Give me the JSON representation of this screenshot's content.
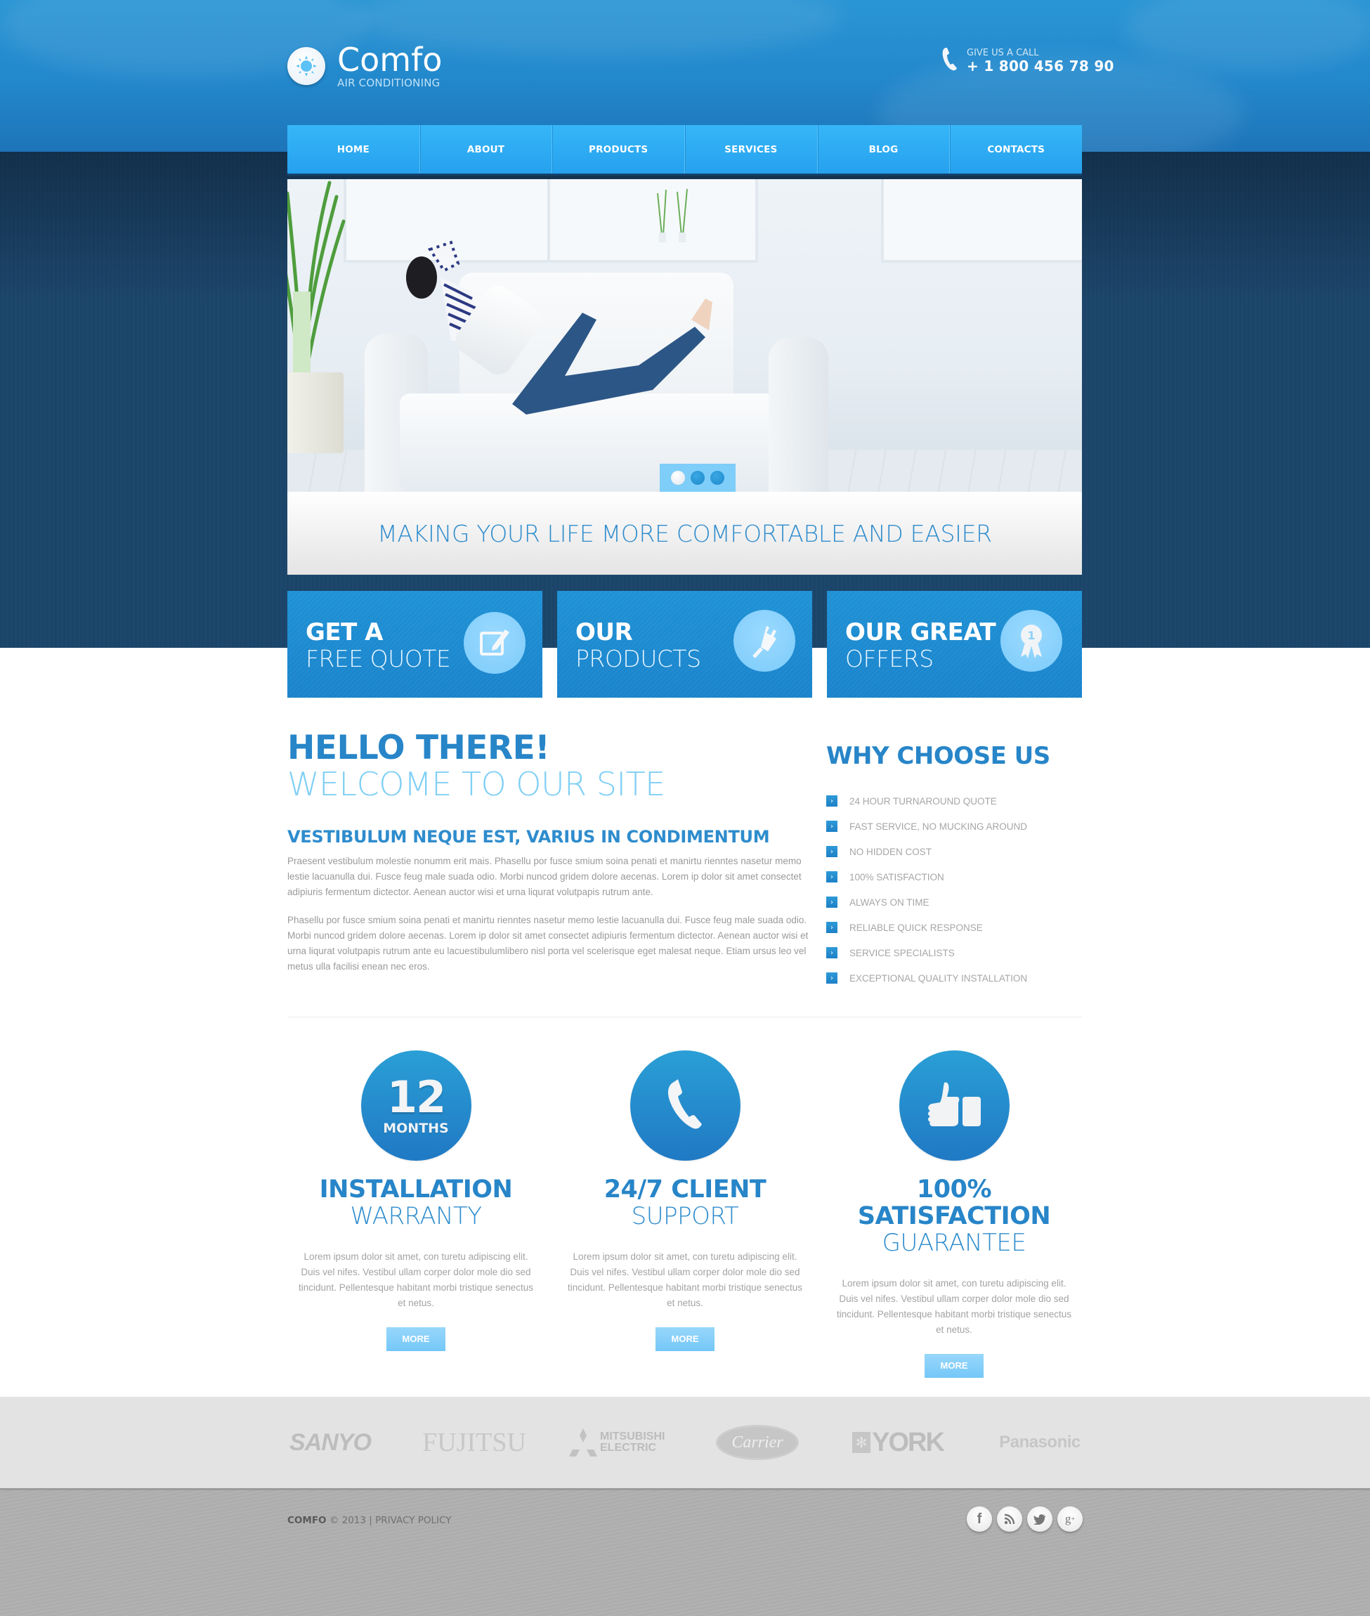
{
  "header": {
    "logo_name": "Comfo",
    "logo_tagline": "AIR CONDITIONING",
    "logo_icon": "sun-icon",
    "phone_label": "GIVE US A CALL",
    "phone_number": "+ 1 800 456 78 90",
    "phone_icon": "phone-icon"
  },
  "nav": {
    "items": [
      {
        "label": "HOME"
      },
      {
        "label": "ABOUT"
      },
      {
        "label": "PRODUCTS"
      },
      {
        "label": "SERVICES"
      },
      {
        "label": "BLOG"
      },
      {
        "label": "CONTACTS"
      }
    ]
  },
  "slider": {
    "slide_count": 3,
    "active_slide": 1,
    "tagline": "MAKING YOUR LIFE MORE COMFORTABLE AND EASIER"
  },
  "feature_boxes": [
    {
      "line1": "GET A",
      "line2": "FREE QUOTE",
      "icon": "edit-icon"
    },
    {
      "line1": "OUR",
      "line2": "PRODUCTS",
      "icon": "plug-icon"
    },
    {
      "line1": "OUR GREAT",
      "line2": "OFFERS",
      "icon": "award-ribbon-icon"
    }
  ],
  "welcome": {
    "title": "HELLO THERE!",
    "subtitle": "WELCOME TO OUR SITE",
    "heading": "VESTIBULUM NEQUE EST, VARIUS IN CONDIMENTUM",
    "paragraphs": [
      "Praesent vestibulum molestie nonumm erit mais. Phasellu por fusce smium soina penati et manirtu rienntes nasetur memo lestie lacuanulla dui. Fusce feug male suada odio. Morbi nuncod gridem dolore aecenas. Lorem ip dolor sit amet consectet adipiuris fermentum dictector. Aenean auctor wisi et urna liqurat volutpapis rutrum ante.",
      "Phasellu por fusce smium soina penati et manirtu rienntes nasetur memo lestie lacuanulla dui. Fusce feug male suada odio. Morbi nuncod gridem dolore aecenas. Lorem ip dolor sit amet consectet adipiuris fermentum dictector. Aenean auctor wisi et urna liqurat volutpapis rutrum ante eu lacuestibulumlibero nisl porta vel scelerisque eget malesat neque. Etiam ursus leo vel metus ulla facilisi enean nec eros."
    ]
  },
  "why_choose": {
    "title": "WHY CHOOSE US",
    "bullet_glyph": "›",
    "items": [
      "24 HOUR TURNAROUND QUOTE",
      "FAST SERVICE, NO MUCKING AROUND",
      "NO HIDDEN COST",
      "100% SATISFACTION",
      "ALWAYS ON TIME",
      "RELIABLE QUICK RESPONSE",
      "SERVICE SPECIALISTS",
      "EXCEPTIONAL QUALITY INSTALLATION"
    ]
  },
  "features": [
    {
      "badge_number": "12",
      "badge_unit": "MONTHS",
      "title_bold": "INSTALLATION",
      "title_light": "WARRANTY",
      "text": "Lorem ipsum dolor sit amet, con turetu adipiscing elit. Duis vel nifes. Vestibul ullam corper dolor mole dio sed tincidunt. Pellentesque habitant morbi tristique senectus et netus.",
      "button": "MORE"
    },
    {
      "icon": "phone-icon",
      "title_bold": "24/7 CLIENT",
      "title_light": "SUPPORT",
      "text": "Lorem ipsum dolor sit amet, con turetu adipiscing elit. Duis vel nifes. Vestibul ullam corper dolor mole dio sed tincidunt. Pellentesque habitant morbi tristique senectus et netus.",
      "button": "MORE"
    },
    {
      "icon": "thumbs-up-icon",
      "title_bold": "100% SATISFACTION",
      "title_light": "GUARANTEE",
      "text": "Lorem ipsum dolor sit amet, con turetu adipiscing elit. Duis vel nifes. Vestibul ullam corper dolor mole dio sed tincidunt. Pellentesque habitant morbi tristique senectus et netus.",
      "button": "MORE"
    }
  ],
  "brands": [
    "SANYO",
    "FUJITSU",
    "MITSUBISHI ELECTRIC",
    "Carrier",
    "YORK",
    "Panasonic"
  ],
  "footer": {
    "brand": "COMFO",
    "copyright": "© 2013",
    "separator": "|",
    "privacy_link": "PRIVACY POLICY",
    "social": [
      {
        "name": "facebook",
        "glyph": "f"
      },
      {
        "name": "rss",
        "glyph": ""
      },
      {
        "name": "twitter",
        "glyph": ""
      },
      {
        "name": "google-plus",
        "glyph": "g+"
      }
    ]
  },
  "colors": {
    "brand_blue": "#2785c8",
    "nav_blue": "#2ea9f2",
    "light_blue": "#80cff5",
    "dark_band": "#1c4468",
    "button_light": "#85cefa",
    "body_text": "#9a9a9a",
    "footer_gray": "#adadad"
  }
}
